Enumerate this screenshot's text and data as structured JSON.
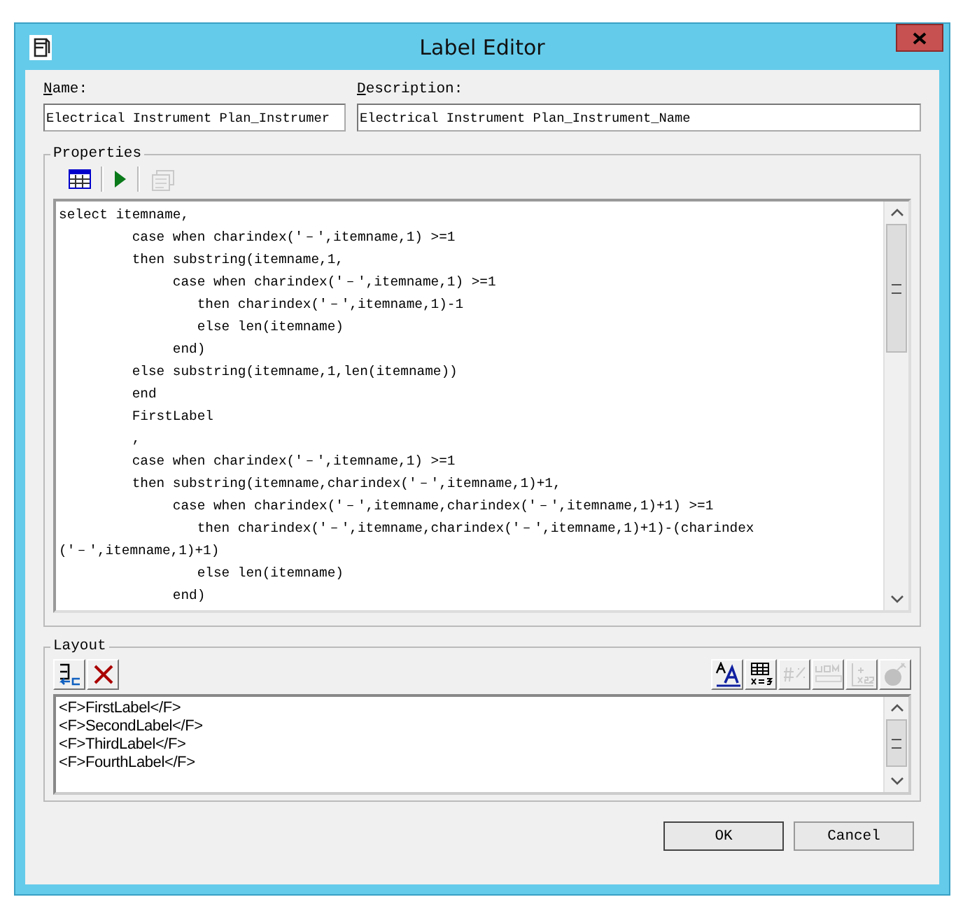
{
  "window": {
    "title": "Label Editor"
  },
  "name_field": {
    "label": "Name:",
    "value": "Electrical Instrument Plan_Instrumer"
  },
  "description_field": {
    "label": "Description:",
    "value": "Electrical Instrument Plan_Instrument_Name"
  },
  "properties": {
    "title": "Properties",
    "toolbar": [
      {
        "kind": "grid",
        "disabled": false
      },
      {
        "kind": "run",
        "disabled": false
      },
      {
        "kind": "properties",
        "disabled": true
      }
    ],
    "code_lines": [
      "select itemname,",
      "         case when charindex('－',itemname,1) >=1",
      "         then substring(itemname,1,",
      "              case when charindex('－',itemname,1) >=1",
      "                 then charindex('－',itemname,1)-1",
      "                 else len(itemname)",
      "              end)",
      "         else substring(itemname,1,len(itemname))",
      "         end",
      "         FirstLabel",
      "         ,",
      "         case when charindex('－',itemname,1) >=1",
      "         then substring(itemname,charindex('－',itemname,1)+1,",
      "              case when charindex('－',itemname,charindex('－',itemname,1)+1) >=1",
      "                 then charindex('－',itemname,charindex('－',itemname,1)+1)-(charindex",
      "('－',itemname,1)+1)",
      "                 else len(itemname)",
      "              end)"
    ]
  },
  "layout": {
    "title": "Layout",
    "toolbar_left": [
      {
        "kind": "insert",
        "disabled": false
      },
      {
        "kind": "delete",
        "disabled": false
      }
    ],
    "toolbar_right": [
      {
        "kind": "font",
        "disabled": false
      },
      {
        "kind": "formula",
        "disabled": false
      },
      {
        "kind": "number-format",
        "disabled": true
      },
      {
        "kind": "uom",
        "disabled": true
      },
      {
        "kind": "subscript",
        "disabled": true
      },
      {
        "kind": "bomb",
        "disabled": true
      }
    ],
    "lines": [
      "<F>FirstLabel</F>",
      "<F>SecondLabel</F>",
      "<F>ThirdLabel</F>",
      "<F>FourthLabel</F>"
    ]
  },
  "buttons": [
    {
      "label": "OK",
      "kind": "default"
    },
    {
      "label": "Cancel",
      "kind": "normal"
    }
  ]
}
